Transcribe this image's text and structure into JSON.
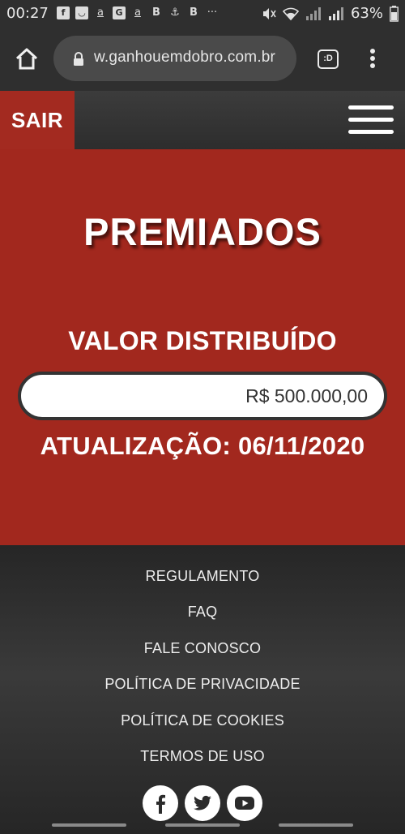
{
  "status_bar": {
    "time": "00:27",
    "notif_icons": [
      "facebook-icon",
      "gmail-icon",
      "amazon-icon",
      "news-icon",
      "amazon-icon",
      "b-app-icon",
      "submarine-icon",
      "b-app-icon",
      "more-icon"
    ],
    "notif_glyphs": [
      "f",
      "◡",
      "a",
      "G",
      "a",
      "B",
      "⚓",
      "B",
      "···"
    ],
    "battery": "63%"
  },
  "browser": {
    "url": "w.ganhouemdobro.com.br",
    "tabs_label": ":D"
  },
  "header": {
    "exit_label": "SAIR"
  },
  "hero": {
    "title": "PREMIADOS",
    "subtitle": "VALOR DISTRIBUÍDO",
    "amount": "R$ 500.000,00",
    "update": "ATUALIZAÇÃO: 06/11/2020"
  },
  "footer": {
    "links": [
      "REGULAMENTO",
      "FAQ",
      "FALE CONOSCO",
      "POLÍTICA DE PRIVACIDADE",
      "POLÍTICA DE COOKIES",
      "TERMOS DE USO"
    ],
    "social": [
      "facebook-icon",
      "twitter-icon",
      "youtube-icon"
    ]
  },
  "colors": {
    "brand_red": "#a2281e",
    "dark": "#2f2f2f"
  }
}
